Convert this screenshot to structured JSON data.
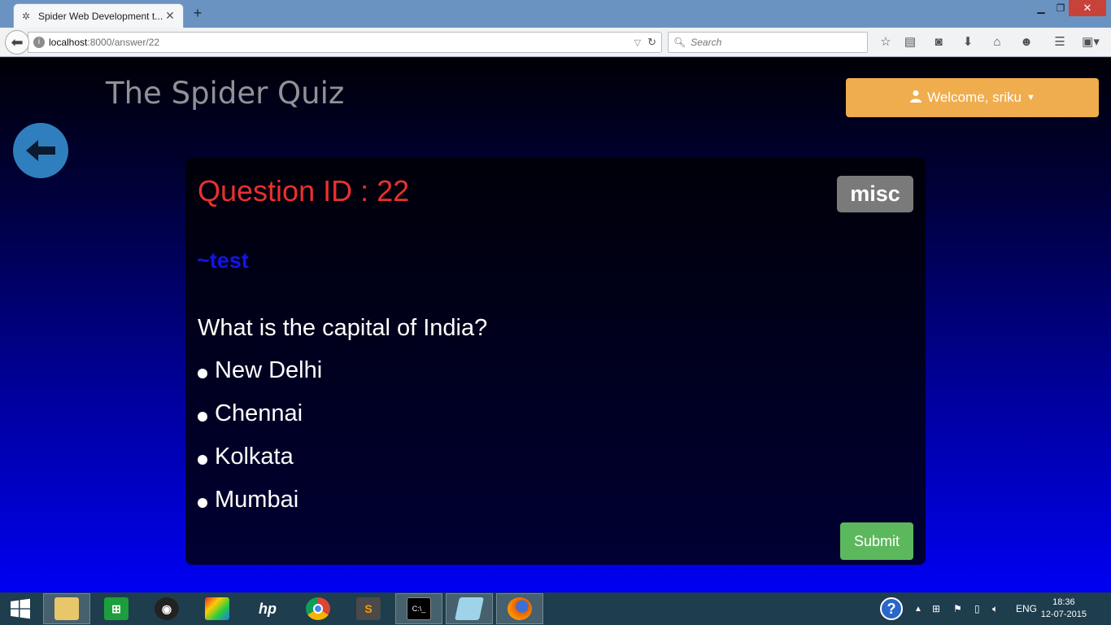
{
  "browser": {
    "tab_title": "Spider Web Development t...",
    "url_host": "localhost",
    "url_path": ":8000/answer/22",
    "search_placeholder": "Search"
  },
  "header": {
    "site_title": "The Spider Quiz",
    "welcome_label": "Welcome, sriku"
  },
  "question": {
    "id_label": "Question ID : 22",
    "category": "misc",
    "author": "~test",
    "text": "What is the capital of India?",
    "options": [
      "New Delhi",
      "Chennai",
      "Kolkata",
      "Mumbai"
    ],
    "submit_label": "Submit"
  },
  "taskbar": {
    "language": "ENG",
    "time": "18:36",
    "date": "12-07-2015"
  },
  "colors": {
    "accent_welcome": "#f0ad4e",
    "question_id": "#e8312f",
    "author": "#1414e8",
    "submit": "#5cb85c"
  }
}
